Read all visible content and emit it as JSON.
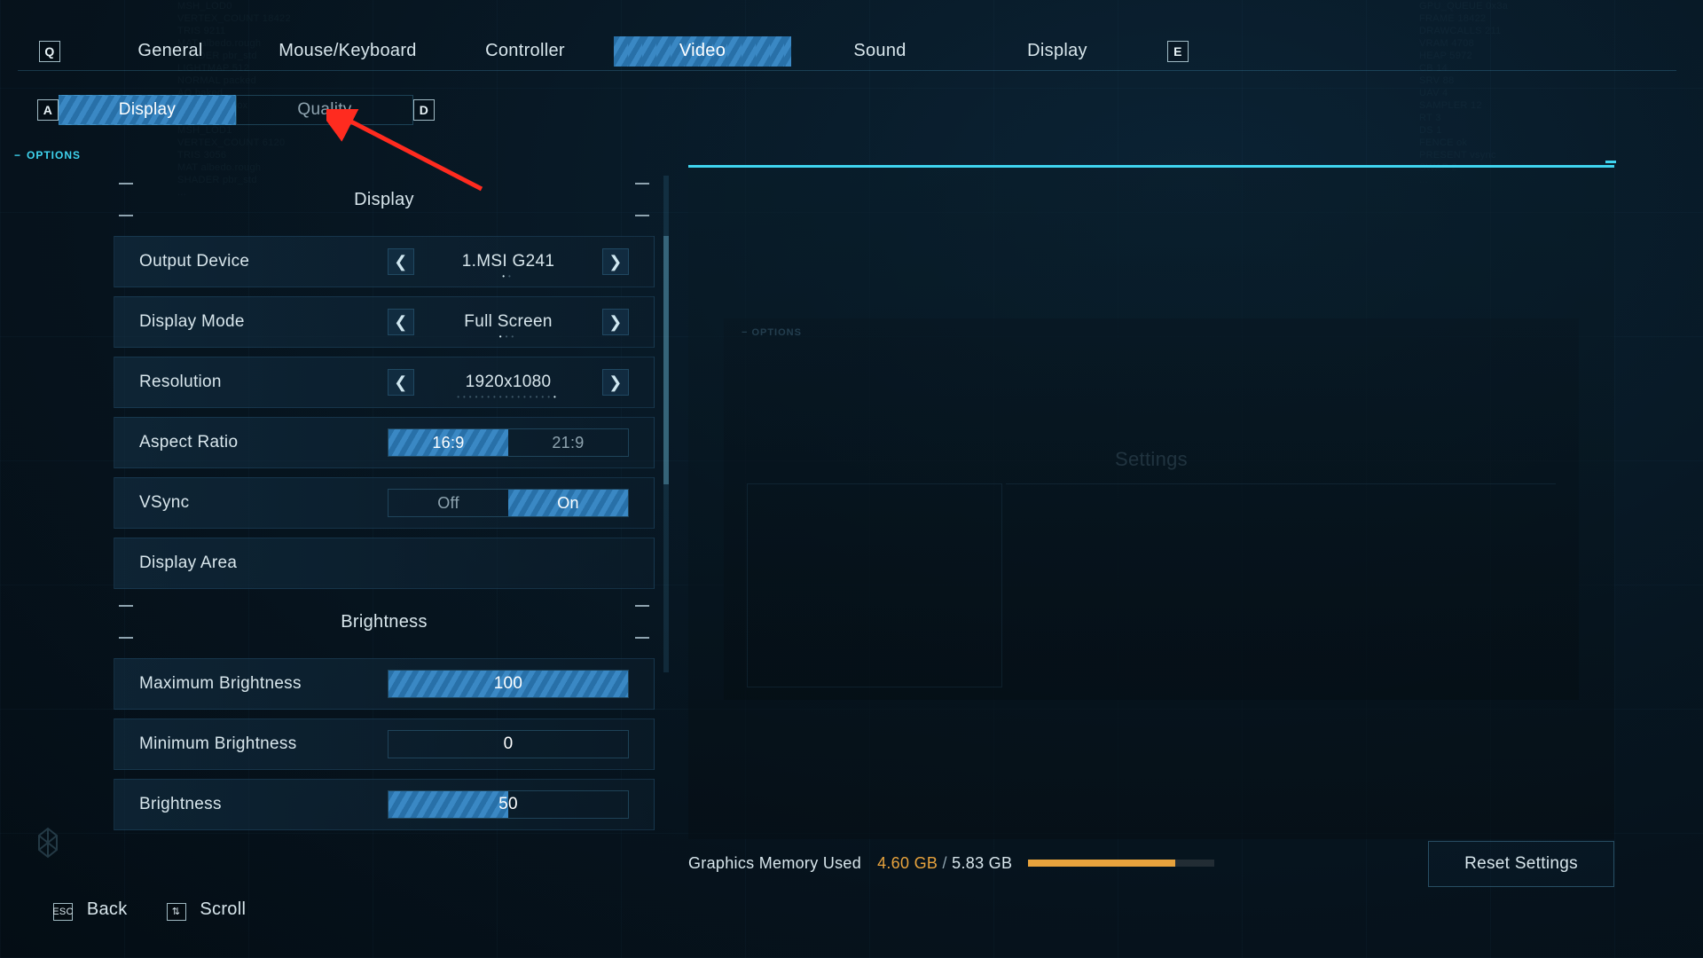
{
  "keycaps": {
    "q": "Q",
    "e": "E",
    "a": "A",
    "d": "D",
    "esc": "ESC",
    "scroll": "⇅"
  },
  "tabs": {
    "items": [
      "General",
      "Mouse/Keyboard",
      "Controller",
      "Video",
      "Sound",
      "Display"
    ],
    "activeIndex": 3
  },
  "subtabs": {
    "items": [
      "Display",
      "Quality"
    ],
    "activeIndex": 0
  },
  "options_label": "OPTIONS",
  "sections": {
    "display": "Display",
    "brightness": "Brightness"
  },
  "rows": {
    "output_device": {
      "label": "Output Device",
      "value": "1.MSI G241",
      "dots": 2,
      "dot_on": 0
    },
    "display_mode": {
      "label": "Display Mode",
      "value": "Full Screen",
      "dots": 3,
      "dot_on": 0
    },
    "resolution": {
      "label": "Resolution",
      "value": "1920x1080",
      "dots": 17,
      "dot_on": 16
    },
    "aspect_ratio": {
      "label": "Aspect Ratio",
      "options": [
        "16:9",
        "21:9"
      ],
      "on": 0
    },
    "vsync": {
      "label": "VSync",
      "options": [
        "Off",
        "On"
      ],
      "on": 1
    },
    "display_area": {
      "label": "Display Area"
    },
    "max_bright": {
      "label": "Maximum Brightness",
      "value": "100",
      "pct": 100
    },
    "min_bright": {
      "label": "Minimum Brightness",
      "value": "0",
      "pct": 0
    },
    "brightness": {
      "label": "Brightness",
      "value": "50",
      "pct": 50
    }
  },
  "preview": {
    "tag": "OPTIONS",
    "title": "Settings"
  },
  "gpu": {
    "label": "Graphics Memory Used",
    "used": "4.60 GB",
    "total": "5.83 GB",
    "pct": 79
  },
  "reset_label": "Reset Settings",
  "footer": {
    "back": "Back",
    "scroll": "Scroll"
  }
}
